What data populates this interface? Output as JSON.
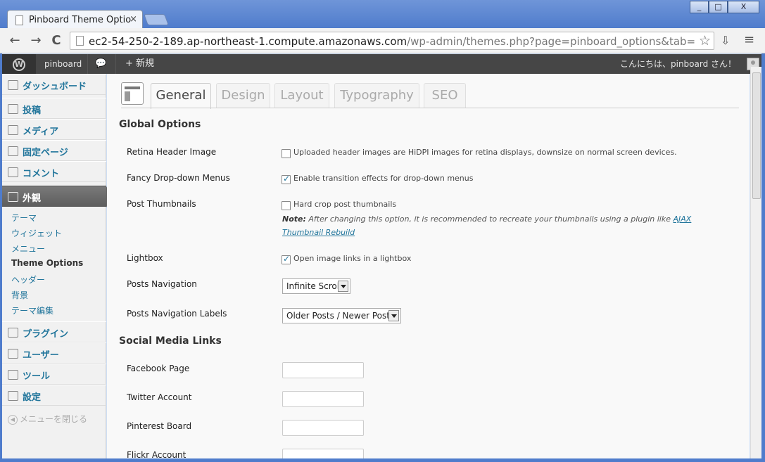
{
  "browser": {
    "tab_title": "Pinboard Theme Option",
    "tab_close": "×",
    "url_host": "ec2-54-250-2-189.ap-northeast-1.compute.amazonaws.com",
    "url_path": "/wp-admin/themes.php?page=pinboard_options&tab=ge",
    "window_buttons": [
      "_",
      "□",
      "X"
    ],
    "nav_icons": [
      "back-arrow",
      "forward-arrow",
      "reload"
    ],
    "back_glyph": "←",
    "forward_glyph": "→",
    "reload_glyph": "C",
    "star_glyph": "☆",
    "ext_glyph": "⇩",
    "menu_glyph": "≡"
  },
  "adminbar": {
    "site_name": "pinboard",
    "comment_glyph": "💬",
    "new_label": "+ 新規",
    "greeting": "こんにちは、pinboard さん！"
  },
  "sidebar": {
    "items": [
      {
        "label": "ダッシュボード",
        "icon": "home-icon"
      },
      {
        "label": "投稿",
        "icon": "pin-icon"
      },
      {
        "label": "メディア",
        "icon": "media-icon"
      },
      {
        "label": "固定ページ",
        "icon": "pages-icon"
      },
      {
        "label": "コメント",
        "icon": "comment-icon"
      },
      {
        "label": "外観",
        "icon": "appearance-icon"
      },
      {
        "label": "プラグイン",
        "icon": "plugin-icon"
      },
      {
        "label": "ユーザー",
        "icon": "users-icon"
      },
      {
        "label": "ツール",
        "icon": "tools-icon"
      },
      {
        "label": "設定",
        "icon": "settings-icon"
      }
    ],
    "submenu": [
      "テーマ",
      "ウィジェット",
      "メニュー",
      "Theme Options",
      "ヘッダー",
      "背景",
      "テーマ編集"
    ],
    "collapse_label": "メニューを閉じる",
    "collapse_glyph": "◀"
  },
  "tabs": [
    "General",
    "Design",
    "Layout",
    "Typography",
    "SEO"
  ],
  "sections": {
    "global": "Global Options",
    "social": "Social Media Links"
  },
  "options": {
    "retina_label": "Retina Header Image",
    "retina_text": "Uploaded header images are HiDPI images for retina displays, downsize on normal screen devices.",
    "retina_checked": false,
    "fancy_label": "Fancy Drop-down Menus",
    "fancy_text": "Enable transition effects for drop-down menus",
    "fancy_checked": true,
    "thumbs_label": "Post Thumbnails",
    "thumbs_text": "Hard crop post thumbnails",
    "thumbs_checked": false,
    "note_bold": "Note:",
    "note_text": " After changing this option, it is recommended to recreate your thumbnails using a plugin like ",
    "note_link": "AJAX Thumbnail Rebuild",
    "lightbox_label": "Lightbox",
    "lightbox_text": "Open image links in a lightbox",
    "lightbox_checked": true,
    "nav_label": "Posts Navigation",
    "nav_value": "Infinite Scroll",
    "navlabels_label": "Posts Navigation Labels",
    "navlabels_value": "Older Posts / Newer Posts"
  },
  "social": {
    "facebook_label": "Facebook Page",
    "twitter_label": "Twitter Account",
    "pinterest_label": "Pinterest Board",
    "flickr_label": "Flickr Account",
    "facebook_value": "",
    "twitter_value": "",
    "pinterest_value": "",
    "flickr_value": ""
  },
  "colors": {
    "link": "#21759b",
    "adminbar": "#464646",
    "chrome_frame": "#4f7ccc"
  }
}
